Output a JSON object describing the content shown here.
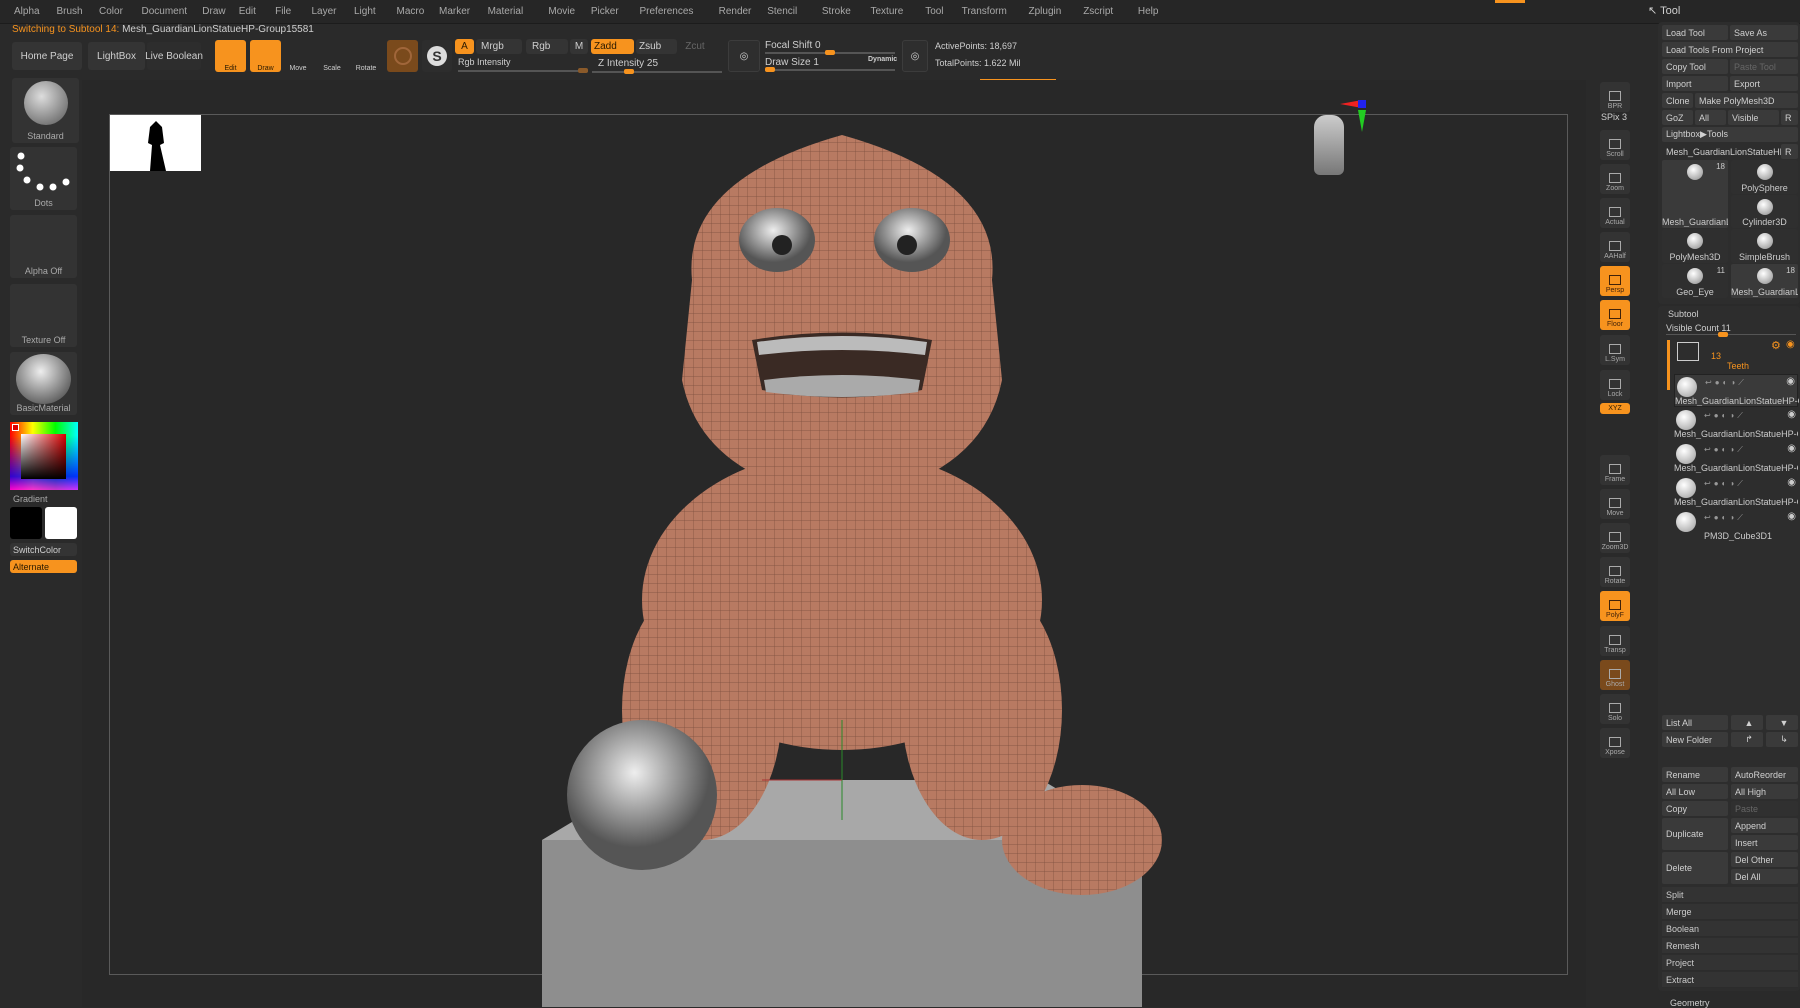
{
  "menu": [
    "Alpha",
    "Brush",
    "Color",
    "Document",
    "Draw",
    "Edit",
    "File",
    "Layer",
    "Light",
    "Macro",
    "Marker",
    "Material",
    "Movie",
    "Picker",
    "Preferences",
    "Render",
    "Stencil",
    "Stroke",
    "Texture",
    "Tool",
    "Transform",
    "Zplugin",
    "Zscript",
    "Help"
  ],
  "status": {
    "prefix": "Switching to Subtool 14:",
    "name": "Mesh_GuardianLionStatueHP-Group15581"
  },
  "toolbar": {
    "home_page": "Home Page",
    "lightbox": "LightBox",
    "live_boolean": "Live Boolean",
    "edit": "Edit",
    "draw": "Draw",
    "move": "Move",
    "scale": "Scale",
    "rotate": "Rotate",
    "a": "A",
    "mrgb": "Mrgb",
    "rgb": "Rgb",
    "m": "M",
    "zadd": "Zadd",
    "zsub": "Zsub",
    "zcut": "Zcut",
    "rgb_intensity": "Rgb Intensity",
    "z_intensity": "Z Intensity 25",
    "focal_shift": "Focal Shift 0",
    "draw_size": "Draw Size 1",
    "dynamic": "Dynamic",
    "active_points": "ActivePoints: 18,697",
    "total_points": "TotalPoints: 1.622 Mil",
    "z_intensity_value": 25,
    "focal_shift_value": 0,
    "draw_size_value": 1
  },
  "left_shelf": {
    "brush": "Standard",
    "stroke": "Dots",
    "alpha": "Alpha Off",
    "texture": "Texture Off",
    "material": "BasicMaterial",
    "gradient": "Gradient",
    "switch_color": "SwitchColor",
    "alternate": "Alternate",
    "main_color": "#000000",
    "secondary_color": "#ffffff"
  },
  "right_toolbar": [
    {
      "label": "BPR",
      "active": false
    },
    {
      "label": "Scroll",
      "active": false
    },
    {
      "label": "Zoom",
      "active": false
    },
    {
      "label": "Actual",
      "active": false
    },
    {
      "label": "AAHalf",
      "active": false
    },
    {
      "label": "Persp",
      "active": true
    },
    {
      "label": "Floor",
      "active": true
    },
    {
      "label": "L.Sym",
      "active": false
    },
    {
      "label": "Lock",
      "active": false
    },
    {
      "label": "Frame",
      "active": false
    },
    {
      "label": "Move",
      "active": false
    },
    {
      "label": "Zoom3D",
      "active": false
    },
    {
      "label": "Rotate",
      "active": false
    },
    {
      "label": "PolyF",
      "active": true
    },
    {
      "label": "Transp",
      "active": false
    },
    {
      "label": "Ghost",
      "active": false
    },
    {
      "label": "Solo",
      "active": false
    },
    {
      "label": "Xpose",
      "active": false
    }
  ],
  "spix": "SPix 3",
  "xyz": "XYZ",
  "tool_panel": {
    "title": "Tool",
    "load_tool": "Load Tool",
    "save_as": "Save As",
    "load_from_project": "Load Tools From Project",
    "copy_tool": "Copy Tool",
    "paste_tool": "Paste Tool",
    "import": "Import",
    "export": "Export",
    "clone": "Clone",
    "make_polymesh": "Make PolyMesh3D",
    "goz": "GoZ",
    "all": "All",
    "visible": "Visible",
    "r": "R",
    "lightbox_tools": "Lightbox▶Tools",
    "current_tool": "Mesh_GuardianLionStatueHP",
    "tools": [
      {
        "name": "Mesh_GuardianL",
        "count": "18"
      },
      {
        "name": "PolySphere",
        "count": ""
      },
      {
        "name": "Cylinder3D",
        "count": ""
      },
      {
        "name": "PolyMesh3D",
        "count": ""
      },
      {
        "name": "SimpleBrush",
        "count": ""
      },
      {
        "name": "Geo_Eye",
        "count": "11"
      },
      {
        "name": "Mesh_GuardianL",
        "count": "18"
      }
    ]
  },
  "subtool": {
    "title": "Subtool",
    "visible_count": "Visible Count 11",
    "folder": {
      "count": "13",
      "name": "Teeth"
    },
    "items": [
      "Mesh_GuardianLionStatueHP-G",
      "Mesh_GuardianLionStatueHP-G",
      "Mesh_GuardianLionStatueHP-G",
      "Mesh_GuardianLionStatueHP-G",
      "PM3D_Cube3D1"
    ],
    "list_all": "List All",
    "new_folder": "New Folder",
    "rename": "Rename",
    "auto_reorder": "AutoReorder",
    "all_low": "All Low",
    "all_high": "All High",
    "copy": "Copy",
    "paste": "Paste",
    "duplicate": "Duplicate",
    "append": "Append",
    "insert": "Insert",
    "delete": "Delete",
    "del_other": "Del Other",
    "del_all": "Del All",
    "actions": [
      "Split",
      "Merge",
      "Boolean",
      "Remesh",
      "Project",
      "Extract"
    ],
    "geometry": "Geometry"
  },
  "colors": {
    "accent": "#f7931e",
    "background": "#282828",
    "model": "#b87a62"
  }
}
